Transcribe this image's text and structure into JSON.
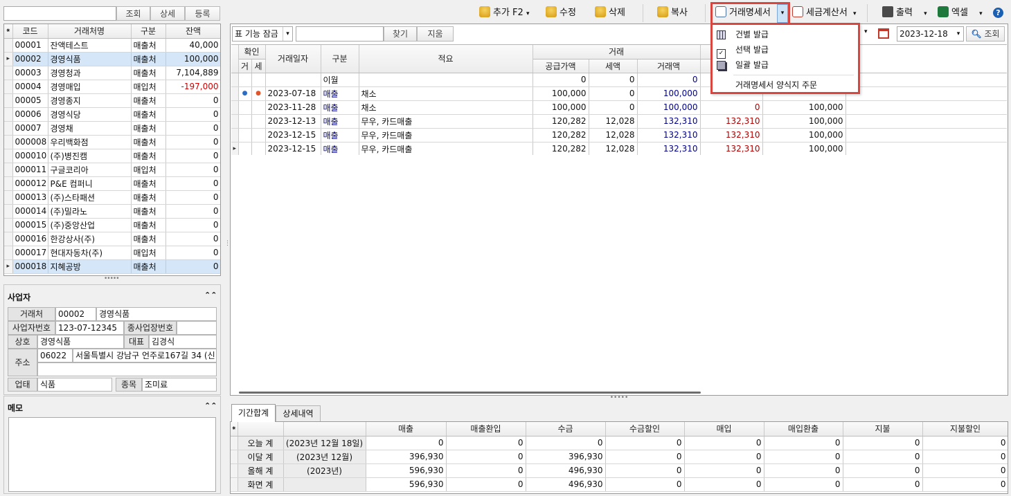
{
  "left_toolbar": {
    "search_value": "",
    "view_label": "조회",
    "detail_label": "상세",
    "register_label": "등록"
  },
  "client_grid": {
    "headers": [
      "코드",
      "거래처명",
      "구분",
      "잔액"
    ],
    "rows": [
      {
        "code": "00001",
        "name": "잔액테스트",
        "type": "매출처",
        "balance": "40,000"
      },
      {
        "code": "00002",
        "name": "경영식품",
        "type": "매출처",
        "balance": "100,000"
      },
      {
        "code": "00003",
        "name": "경영청과",
        "type": "매출처",
        "balance": "7,104,889"
      },
      {
        "code": "00004",
        "name": "경영매입",
        "type": "매입처",
        "balance": "-197,000"
      },
      {
        "code": "00005",
        "name": "경영종지",
        "type": "매출처",
        "balance": "0"
      },
      {
        "code": "00006",
        "name": "경영식당",
        "type": "매출처",
        "balance": "0"
      },
      {
        "code": "00007",
        "name": "경영채",
        "type": "매출처",
        "balance": "0"
      },
      {
        "code": "000008",
        "name": "우리백화점",
        "type": "매출처",
        "balance": "0"
      },
      {
        "code": "000010",
        "name": "(주)병진캠",
        "type": "매출처",
        "balance": "0"
      },
      {
        "code": "000011",
        "name": "구글코리아",
        "type": "매입처",
        "balance": "0"
      },
      {
        "code": "000012",
        "name": "P&E 컴퍼니",
        "type": "매출처",
        "balance": "0"
      },
      {
        "code": "000013",
        "name": "(주)스타패션",
        "type": "매출처",
        "balance": "0"
      },
      {
        "code": "000014",
        "name": "(주)밀라노",
        "type": "매출처",
        "balance": "0"
      },
      {
        "code": "000015",
        "name": "(주)중앙산업",
        "type": "매출처",
        "balance": "0"
      },
      {
        "code": "000016",
        "name": "한강상사(주)",
        "type": "매출처",
        "balance": "0"
      },
      {
        "code": "000017",
        "name": "현대자동차(주)",
        "type": "매입처",
        "balance": "0"
      },
      {
        "code": "000018",
        "name": "지혜공방",
        "type": "매출처",
        "balance": "0"
      }
    ]
  },
  "business": {
    "title": "사업자",
    "client_label": "거래처",
    "client_code": "00002",
    "client_name": "경영식품",
    "bizno_label": "사업자번호",
    "bizno": "123-07-12345",
    "sub_label": "종사업장번호",
    "sub_value": "",
    "company_label": "상호",
    "company": "경영식품",
    "rep_label": "대표",
    "rep": "김경식",
    "address_label": "주소",
    "zip": "06022",
    "address": "서울특별시 강남구 언주로167길 34 (신",
    "biztype_label": "업태",
    "biztype": "식품",
    "item_label": "종목",
    "item": "조미료"
  },
  "memo": {
    "title": "메모"
  },
  "toolbar": {
    "add": "추가 F2",
    "edit": "수정",
    "delete": "삭제",
    "copy": "복사",
    "statement": "거래명세서",
    "tax_invoice": "세금계산서",
    "print": "출력",
    "excel": "엑셀",
    "help": "?"
  },
  "statement_menu": {
    "items": [
      "건별 발급",
      "선택 발급",
      "일괄 발급"
    ],
    "footer": "거래명세서 양식지 주문"
  },
  "filter": {
    "lock": "표 기능 잠금",
    "find": "찾기",
    "clear": "지움",
    "date": "2023-12-18",
    "search": "조회"
  },
  "tx_grid": {
    "group_confirm": "확인",
    "group_tx": "거래",
    "headers": {
      "c1": "거",
      "c2": "세",
      "date": "거래일자",
      "type": "구분",
      "memo": "적요",
      "supply": "공급가액",
      "tax": "세액",
      "amount": "거래액"
    },
    "rows": [
      {
        "d1": "",
        "d2": "",
        "date": "",
        "type": "이월",
        "memo": "",
        "supply": "0",
        "tax": "0",
        "amount": "0",
        "paid": "",
        "bal": ""
      },
      {
        "d1": "●",
        "d2": "●",
        "date": "2023-07-18",
        "type": "매출",
        "memo": "채소",
        "supply": "100,000",
        "tax": "0",
        "amount": "100,000",
        "paid": "",
        "bal": ""
      },
      {
        "d1": "",
        "d2": "",
        "date": "2023-11-28",
        "type": "매출",
        "memo": "채소",
        "supply": "100,000",
        "tax": "0",
        "amount": "100,000",
        "paid": "0",
        "bal": "100,000"
      },
      {
        "d1": "",
        "d2": "",
        "date": "2023-12-13",
        "type": "매출",
        "memo": "무우, 카드매출",
        "supply": "120,282",
        "tax": "12,028",
        "amount": "132,310",
        "paid": "132,310",
        "bal": "100,000"
      },
      {
        "d1": "",
        "d2": "",
        "date": "2023-12-15",
        "type": "매출",
        "memo": "무우, 카드매출",
        "supply": "120,282",
        "tax": "12,028",
        "amount": "132,310",
        "paid": "132,310",
        "bal": "100,000"
      },
      {
        "d1": "",
        "d2": "",
        "date": "2023-12-15",
        "type": "매출",
        "memo": "무우, 카드매출",
        "supply": "120,282",
        "tax": "12,028",
        "amount": "132,310",
        "paid": "132,310",
        "bal": "100,000"
      }
    ]
  },
  "bottom": {
    "tabs": [
      "기간합계",
      "상세내역"
    ],
    "headers": [
      "매출",
      "매출환입",
      "수금",
      "수금할인",
      "매입",
      "매입환출",
      "지불",
      "지불할인"
    ],
    "rows": [
      {
        "label": "오늘 계",
        "period": "(2023년 12월 18일)",
        "v": [
          "0",
          "0",
          "0",
          "0",
          "0",
          "0",
          "0",
          "0"
        ]
      },
      {
        "label": "이달 계",
        "period": "(2023년 12월)",
        "v": [
          "396,930",
          "0",
          "396,930",
          "0",
          "0",
          "0",
          "0",
          "0"
        ]
      },
      {
        "label": "올해 계",
        "period": "(2023년)",
        "v": [
          "596,930",
          "0",
          "496,930",
          "0",
          "0",
          "0",
          "0",
          "0"
        ]
      },
      {
        "label": "화면 계",
        "period": "",
        "v": [
          "596,930",
          "0",
          "496,930",
          "0",
          "0",
          "0",
          "0",
          "0"
        ]
      }
    ]
  },
  "colors": {
    "highlight": "#d9453f",
    "selected_row": "#d4e6f7",
    "accent_blue": "#0010a0",
    "negative": "#d40000"
  }
}
